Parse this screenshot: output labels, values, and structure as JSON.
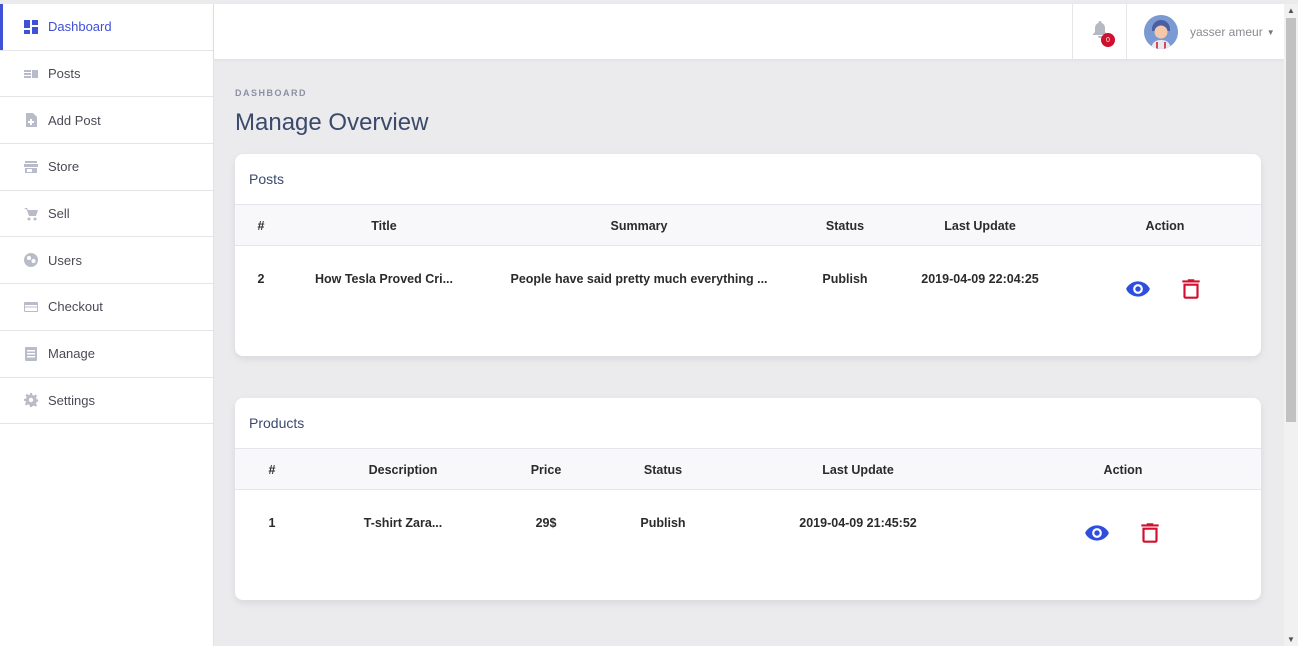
{
  "sidebar": {
    "items": [
      {
        "label": "Dashboard",
        "icon": "dashboard-icon",
        "active": true
      },
      {
        "label": "Posts",
        "icon": "posts-icon"
      },
      {
        "label": "Add Post",
        "icon": "add-post-icon"
      },
      {
        "label": "Store",
        "icon": "store-icon"
      },
      {
        "label": "Sell",
        "icon": "cart-icon"
      },
      {
        "label": "Users",
        "icon": "users-icon"
      },
      {
        "label": "Checkout",
        "icon": "credit-card-icon"
      },
      {
        "label": "Manage",
        "icon": "manage-icon"
      },
      {
        "label": "Settings",
        "icon": "gear-icon"
      }
    ]
  },
  "topbar": {
    "notification_count": "0",
    "user_name": "yasser ameur"
  },
  "main": {
    "breadcrumb": "DASHBOARD",
    "title": "Manage Overview"
  },
  "posts": {
    "title": "Posts",
    "columns": [
      "#",
      "Title",
      "Summary",
      "Status",
      "Last Update",
      "Action"
    ],
    "rows": [
      {
        "id": "2",
        "title": "How Tesla Proved Cri...",
        "summary": "People have said pretty much everything ...",
        "status": "Publish",
        "updated": "2019-04-09 22:04:25"
      }
    ]
  },
  "products": {
    "title": "Products",
    "columns": [
      "#",
      "Description",
      "Price",
      "Status",
      "Last Update",
      "Action"
    ],
    "rows": [
      {
        "id": "1",
        "description": "T-shirt Zara...",
        "price": "29$",
        "status": "Publish",
        "updated": "2019-04-09 21:45:52"
      }
    ]
  },
  "colors": {
    "accent": "#3f51d6",
    "view": "#2f4ee0",
    "delete": "#d0102e",
    "title": "#3b4a6b"
  }
}
